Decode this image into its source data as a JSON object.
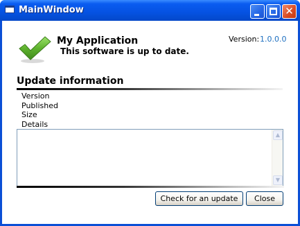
{
  "window": {
    "title": "MainWindow",
    "controls": {
      "minimize_icon": "minimize-icon",
      "maximize_icon": "maximize-icon",
      "close_glyph": "✕"
    }
  },
  "header": {
    "app_name": "My Application",
    "status": "This software is up to date.",
    "version_label": "Version:",
    "version_value": "1.0.0.0",
    "status_icon": "checkmark-icon",
    "colors": {
      "check": "#5fb32e",
      "version_value": "#1d6fc0"
    }
  },
  "update_info": {
    "title": "Update information",
    "labels": [
      "Version",
      "Published",
      "Size",
      "Details"
    ],
    "details_text": ""
  },
  "buttons": {
    "check_update": "Check for an update",
    "close": "Close"
  }
}
